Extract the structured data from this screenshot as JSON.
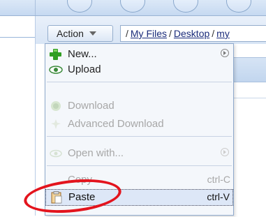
{
  "toolbar": {
    "action_label": "Action",
    "path": {
      "segments": [
        "My Files",
        "Desktop",
        "my"
      ],
      "leading_sep": "/",
      "sep": "/"
    }
  },
  "menu": {
    "items": [
      {
        "label": "New...",
        "icon": "green-plus-icon",
        "submenu": true,
        "disabled": false
      },
      {
        "label": "Upload",
        "icon": "eye-upload-icon",
        "disabled": false
      },
      {
        "label": "Download",
        "icon": "download-icon",
        "disabled": true
      },
      {
        "label": "Advanced Download",
        "icon": "advanced-download-icon",
        "disabled": true
      },
      {
        "label": "Open with...",
        "icon": "open-with-icon",
        "submenu": true,
        "disabled": true
      },
      {
        "label": "Copy",
        "shortcut": "ctrl-C",
        "icon": "copy-icon",
        "disabled": true
      },
      {
        "label": "Paste",
        "shortcut": "ctrl-V",
        "icon": "paste-icon",
        "disabled": false,
        "highlighted": true
      }
    ]
  },
  "colors": {
    "accent_blue": "#c6d9f1",
    "highlight": "#dde7f7",
    "annotation_red": "#e3141d",
    "disabled_text": "#a7a7a7"
  }
}
